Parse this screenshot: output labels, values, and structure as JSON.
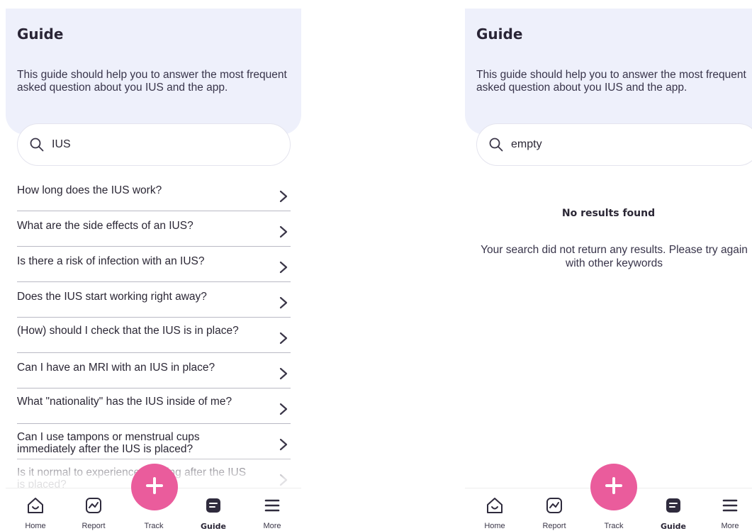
{
  "colors": {
    "header_bg": "#eef0fb",
    "accent": "#ea5c9c",
    "text": "#2b2735",
    "divider": "#b9b9c4"
  },
  "left": {
    "title": "Guide",
    "description": "This guide should help you to answer the most frequent asked question about you IUS and the app.",
    "search": {
      "icon": "search-icon",
      "value": "IUS"
    },
    "faqs": [
      {
        "question": "How long does the IUS work?"
      },
      {
        "question": "What are the side effects of an IUS?"
      },
      {
        "question": "Is there a risk of infection with an IUS?"
      },
      {
        "question": "Does the IUS start working right away?"
      },
      {
        "question": "(How) should I check that the IUS is in place?"
      },
      {
        "question": "Can I have an MRI with an IUS in place?"
      },
      {
        "question": "What \"nationality\" has the IUS inside of me?"
      },
      {
        "question": "Can I use tampons or menstrual cups immediately after the IUS is placed?"
      },
      {
        "question": "Is it normal to experience spotting after the IUS is placed?"
      }
    ]
  },
  "right": {
    "title": "Guide",
    "description": "This guide should help you to answer the most frequent asked question about you IUS and the app.",
    "search": {
      "icon": "search-icon",
      "value": "empty"
    },
    "empty_state": {
      "title": "No results found",
      "message": "Your search did not return any results. Please try again with other keywords"
    }
  },
  "tabbar": {
    "active": "Guide",
    "tabs": [
      {
        "label": "Home",
        "icon": "home-icon"
      },
      {
        "label": "Report",
        "icon": "chart-icon"
      },
      {
        "label": "Track",
        "icon": "plus-icon"
      },
      {
        "label": "Guide",
        "icon": "guide-icon"
      },
      {
        "label": "More",
        "icon": "menu-icon"
      }
    ]
  }
}
